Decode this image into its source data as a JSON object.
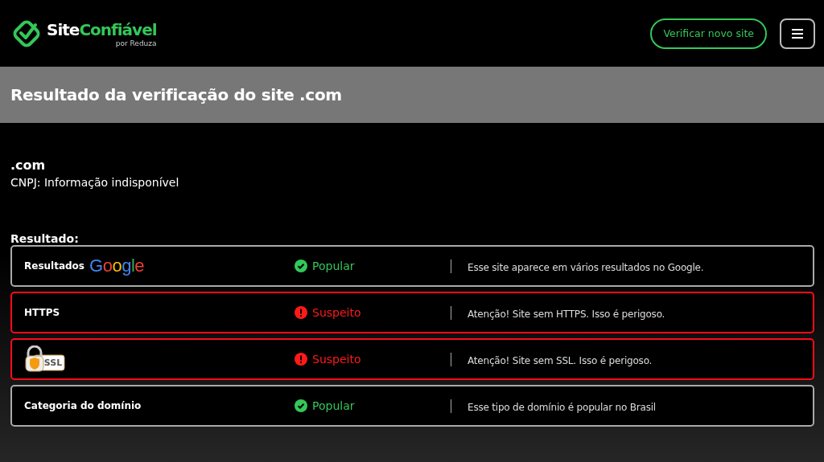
{
  "header": {
    "logo": {
      "part_1": "Site",
      "part_2": "Confiável",
      "byline": "por Reduza"
    },
    "verify_button": "Verificar novo site"
  },
  "banner": {
    "title": "Resultado da verificação do site .com"
  },
  "site": {
    "domain": ".com",
    "cnpj": "CNPJ: Informação indisponível"
  },
  "results": {
    "heading": "Resultado:",
    "rows": [
      {
        "kind": "google",
        "label": "Resultados",
        "logo": "Google",
        "suspicious": false,
        "status_text": "Popular",
        "description": "Esse site aparece em vários resultados no Google."
      },
      {
        "kind": "text",
        "label": "HTTPS",
        "suspicious": true,
        "status_text": "Suspeito",
        "description": "Atenção! Site sem HTTPS. Isso é perigoso."
      },
      {
        "kind": "ssl",
        "badge": "SSL",
        "suspicious": true,
        "status_text": "Suspeito",
        "description": "Atenção! Site sem SSL. Isso é perigoso."
      },
      {
        "kind": "text",
        "label": "Categoria do domínio",
        "suspicious": false,
        "status_text": "Popular",
        "description": "Esse tipo de domínio é popular no Brasil"
      }
    ]
  }
}
